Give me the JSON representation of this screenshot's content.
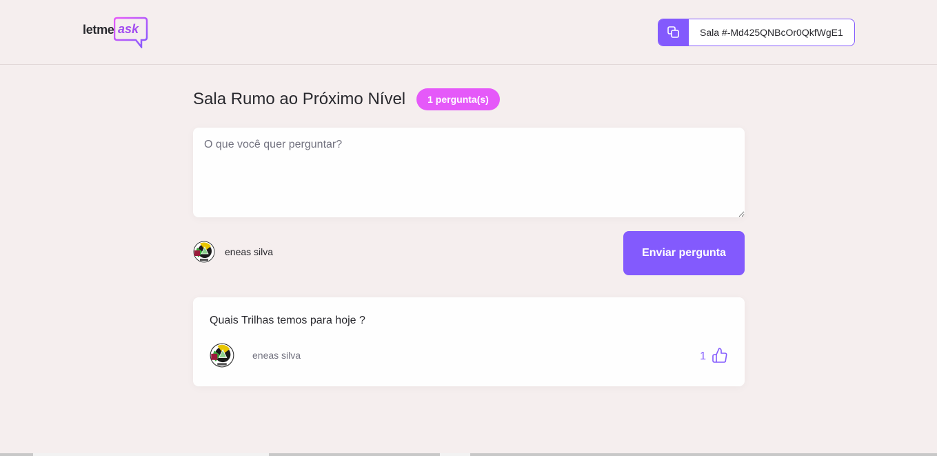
{
  "header": {
    "logo": {
      "prefix": "letme",
      "suffix": "ask"
    },
    "room_code_label": "Sala #-Md425QNBcOr0QkfWgE1",
    "copy_icon": "copy-icon"
  },
  "room": {
    "title": "Sala Rumo ao Próximo Nível",
    "question_count_badge": "1 pergunta(s)"
  },
  "form": {
    "placeholder": "O que você quer perguntar?",
    "value": "",
    "user_name": "eneas silva",
    "submit_label": "Enviar pergunta"
  },
  "questions": [
    {
      "content": "Quais Trilhas temos para hoje ?",
      "author": "eneas silva",
      "like_count": "1"
    }
  ],
  "colors": {
    "accent": "#835afd",
    "badge": "#e559f9",
    "background": "#f5eeee",
    "card": "#fefefe"
  }
}
